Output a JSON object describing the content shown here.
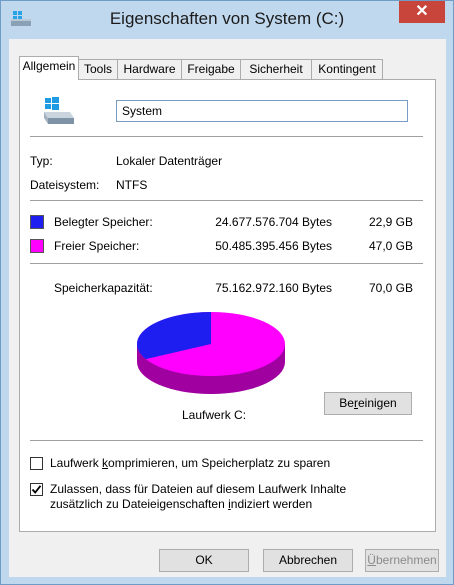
{
  "window": {
    "title": "Eigenschaften von System (C:)",
    "close_glyph": "✕"
  },
  "tabs": [
    "Allgemein",
    "Tools",
    "Hardware",
    "Freigabe",
    "Sicherheit",
    "Kontingent"
  ],
  "general": {
    "drive_name": "System",
    "type_label": "Typ:",
    "type_value": "Lokaler Datenträger",
    "fs_label": "Dateisystem:",
    "fs_value": "NTFS",
    "used_label": "Belegter Speicher:",
    "used_bytes": "24.677.576.704 Bytes",
    "used_gb": "22,9 GB",
    "used_color": "#1e1ef0",
    "free_label": "Freier Speicher:",
    "free_bytes": "50.485.395.456 Bytes",
    "free_gb": "47,0 GB",
    "free_color": "#ff00ff",
    "capacity_label": "Speicherkapazität:",
    "capacity_bytes": "75.162.972.160 Bytes",
    "capacity_gb": "70,0 GB",
    "used_fraction": 0.3283,
    "drive_caption": "Laufwerk C:",
    "cleanup_button_pre": "Be",
    "cleanup_button_u": "r",
    "cleanup_button_post": "einigen",
    "compress_pre": "Laufwerk ",
    "compress_u": "k",
    "compress_post": "omprimieren, um Speicherplatz zu sparen",
    "compress_checked": false,
    "index_pre": "Zulassen, dass für Dateien auf diesem Laufwerk Inhalte",
    "index_line2_pre": "zusätzlich zu Dateieigenschaften ",
    "index_u": "i",
    "index_line2_post": "ndiziert werden",
    "index_checked": true
  },
  "footer": {
    "ok": "OK",
    "cancel": "Abbrechen",
    "apply_u": "Ü",
    "apply_post": "bernehmen"
  }
}
